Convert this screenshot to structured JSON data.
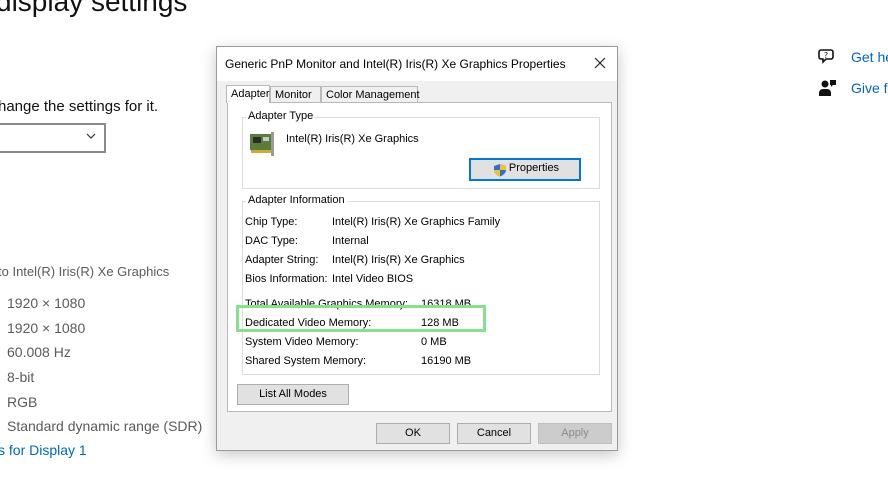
{
  "background": {
    "title": "display settings",
    "description": "hange the settings for it.",
    "connected_to": "to Intel(R) Iris(R) Xe Graphics",
    "values": [
      "1920 × 1080",
      "1920 × 1080",
      "60.008 Hz",
      "8-bit",
      "RGB",
      "Standard dynamic range (SDR)"
    ],
    "link": "s for Display 1"
  },
  "help": {
    "get_help": "Get he",
    "give_feedback": "Give f"
  },
  "dialog": {
    "title": "Generic PnP Monitor and Intel(R) Iris(R) Xe Graphics Properties",
    "tabs": [
      "Adapter",
      "Monitor",
      "Color Management"
    ],
    "adapter_type": {
      "label": "Adapter Type",
      "name": "Intel(R) Iris(R) Xe Graphics",
      "properties_button": "Properties"
    },
    "adapter_info": {
      "label": "Adapter Information",
      "rows": [
        {
          "key": "Chip Type:",
          "value": "Intel(R) Iris(R) Xe Graphics Family"
        },
        {
          "key": "DAC Type:",
          "value": "Internal"
        },
        {
          "key": "Adapter String:",
          "value": "Intel(R) Iris(R) Xe Graphics"
        },
        {
          "key": "Bios Information:",
          "value": "Intel Video BIOS"
        }
      ],
      "memory": [
        {
          "key": "Total Available Graphics Memory:",
          "value": "16318 MB"
        },
        {
          "key": "Dedicated Video Memory:",
          "value": "128 MB"
        },
        {
          "key": "System Video Memory:",
          "value": "0 MB"
        },
        {
          "key": "Shared System Memory:",
          "value": "16190 MB"
        }
      ]
    },
    "list_all_modes": "List All Modes",
    "ok": "OK",
    "cancel": "Cancel",
    "apply": "Apply"
  },
  "colors": {
    "accent_link": "#0067c0",
    "highlight": "#86e08c",
    "focus_border": "#0078d7"
  }
}
